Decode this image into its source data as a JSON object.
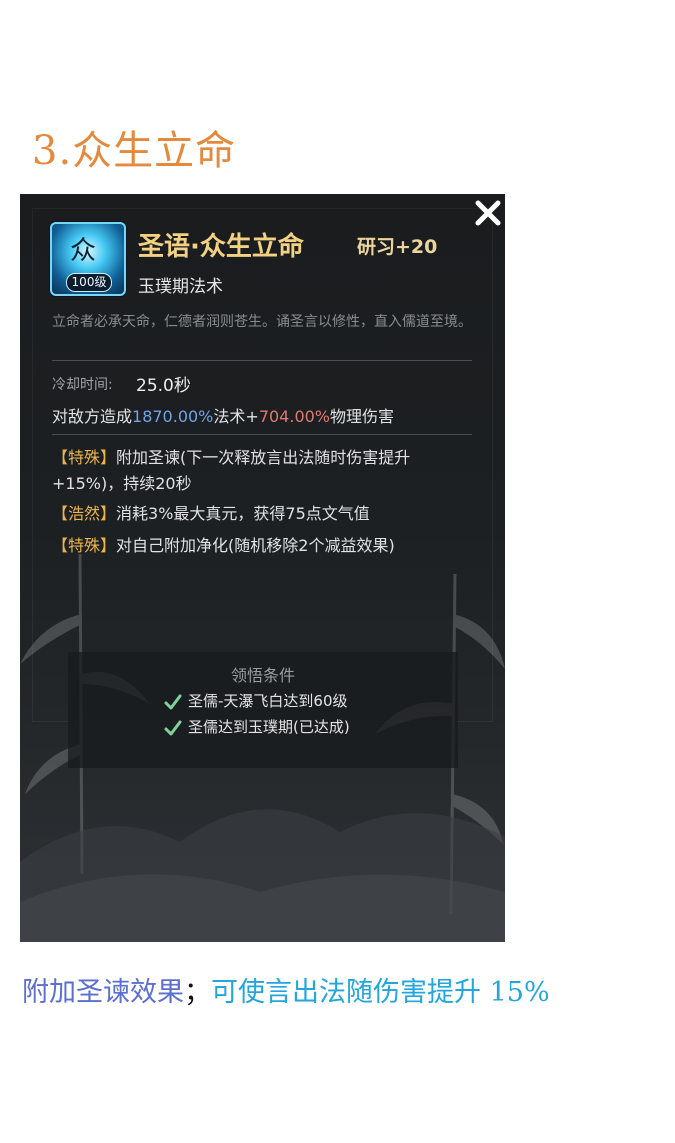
{
  "heading": "3.众生立命",
  "skill": {
    "name": "圣语·众生立命",
    "study": "研习+20",
    "type": "玉璞期法术",
    "icon_glyph": "众",
    "level_badge": "100级",
    "description": "立命者必承天命，仁德者润则苍生。诵圣言以修性，直入儒道至境。",
    "cooldown_label": "冷却时间:",
    "cooldown_value": "25.0秒",
    "damage": {
      "prefix": "对敌方造成",
      "magic_pct": "1870.00%",
      "magic_label": "法术+",
      "phys_pct": "704.00%",
      "phys_label": "物理伤害"
    },
    "effects": [
      {
        "tag": "【特殊】",
        "text": "附加圣谏(下一次释放言出法随时伤害提升+15%)，持续20秒"
      },
      {
        "tag": "【浩然】",
        "text": "消耗3%最大真元，获得75点文气值"
      },
      {
        "tag": "【特殊】",
        "text": "对自己附加净化(随机移除2个减益效果)"
      }
    ],
    "conditions_title": "领悟条件",
    "conditions": [
      "圣儒-天瀑飞白达到60级",
      "圣儒达到玉璞期(已达成)"
    ]
  },
  "caption": {
    "part1": "附加圣谏效果",
    "part2": "；",
    "part3": "可使言出法随伤害提升 15%"
  },
  "colors": {
    "heading": "#e48a3c",
    "skill_name": "#f2d183",
    "tag": "#ebb54b",
    "magic": "#6fa3e8",
    "physical": "#e07972",
    "check": "#7fd39a",
    "caption_blue": "#5a6fd1",
    "caption_cyan": "#22a6dd"
  },
  "icons": [
    "close-icon",
    "check-icon"
  ]
}
